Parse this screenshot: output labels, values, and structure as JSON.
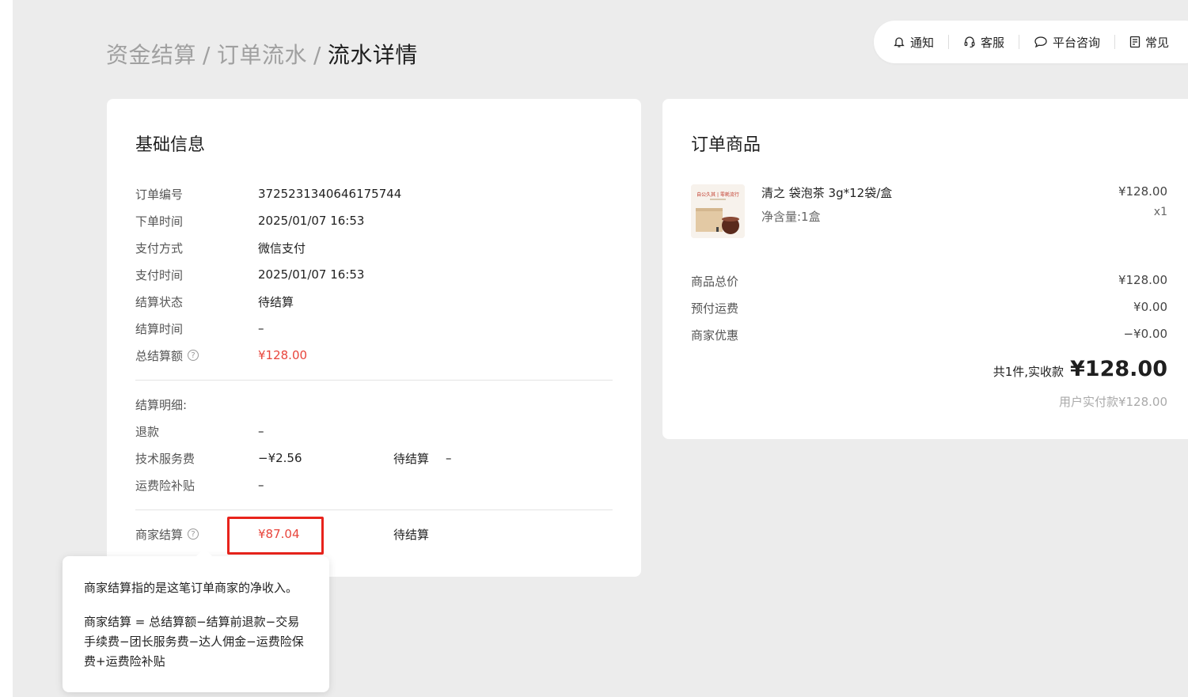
{
  "breadcrumb": {
    "items": [
      "资金结算",
      "订单流水"
    ],
    "current": "流水详情",
    "separator": "/"
  },
  "topbar": {
    "notify": "通知",
    "service": "客服",
    "consult": "平台咨询",
    "faq": "常见"
  },
  "basic": {
    "title": "基础信息",
    "rows": [
      {
        "label": "订单编号",
        "value": "3725231340646175744"
      },
      {
        "label": "下单时间",
        "value": "2025/01/07 16:53"
      },
      {
        "label": "支付方式",
        "value": "微信支付"
      },
      {
        "label": "支付时间",
        "value": "2025/01/07 16:53"
      },
      {
        "label": "结算状态",
        "value": "待结算"
      },
      {
        "label": "结算时间",
        "value": "–"
      },
      {
        "label": "总结算额",
        "value": "¥128.00"
      }
    ],
    "detail_title": "结算明细:",
    "details": [
      {
        "label": "退款",
        "value": "–",
        "status": "",
        "status_value": ""
      },
      {
        "label": "技术服务费",
        "value": "−¥2.56",
        "status": "待结算",
        "status_value": "–"
      },
      {
        "label": "运费险补贴",
        "value": "–",
        "status": "",
        "status_value": ""
      }
    ],
    "merchant": {
      "label": "商家结算",
      "value": "¥87.04",
      "status": "待结算"
    }
  },
  "tooltip": {
    "line1": "商家结算指的是这笔订单商家的净收入。",
    "line2": "商家结算 = 总结算额−结算前退款−交易手续费−团长服务费−达人佣金−运费险保费+运费险补贴"
  },
  "order": {
    "title": "订单商品",
    "product": {
      "name": "清之 袋泡茶 3g*12袋/盒",
      "spec": "净含量:1盒",
      "price": "¥128.00",
      "qty": "x1",
      "thumb_text": "自公久其 | 零耗流行"
    },
    "summary": [
      {
        "label": "商品总价",
        "value": "¥128.00"
      },
      {
        "label": "预付运费",
        "value": "¥0.00"
      },
      {
        "label": "商家优惠",
        "value": "−¥0.00"
      }
    ],
    "total_label": "共1件,实收款",
    "total_amount": "¥128.00",
    "paid_text": "用户实付款¥128.00"
  },
  "colors": {
    "accent_red": "#e8453c",
    "highlight_border": "#e8231c",
    "page_bg": "#ececec"
  }
}
